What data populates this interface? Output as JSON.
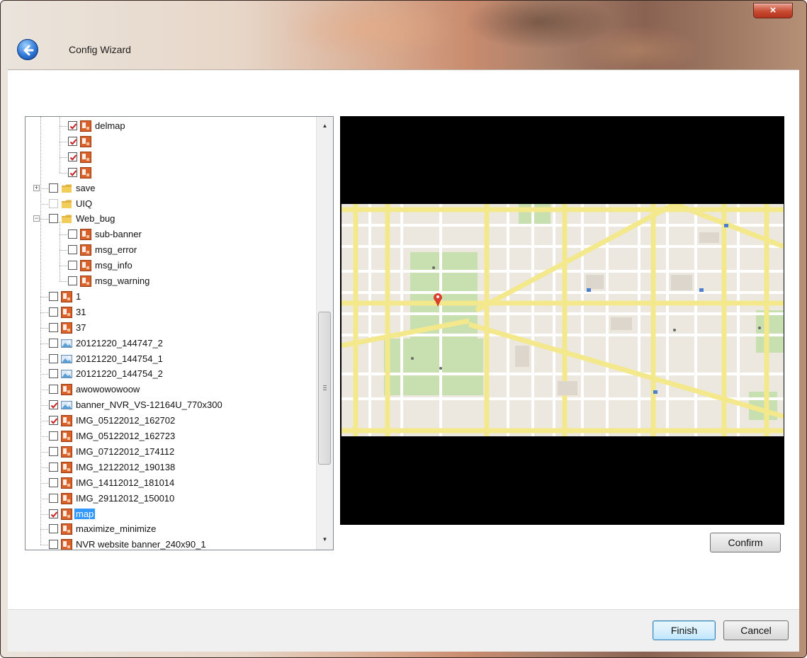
{
  "window": {
    "title": "Config Wizard",
    "close_glyph": "×",
    "back_icon": "back-arrow-icon",
    "close_icon": "close-icon"
  },
  "tree": {
    "items": [
      {
        "label": "delmap",
        "checked": true,
        "icon": "image-file-icon"
      },
      {
        "label": "",
        "checked": true,
        "icon": "image-file-icon"
      },
      {
        "label": "",
        "checked": true,
        "icon": "image-file-icon"
      },
      {
        "label": "",
        "checked": true,
        "icon": "image-file-icon"
      },
      {
        "label": "save",
        "checked": false,
        "icon": "folder-icon",
        "expander": "+"
      },
      {
        "label": "UIQ",
        "checked": false,
        "icon": "folder-icon"
      },
      {
        "label": "Web_bug",
        "checked": false,
        "icon": "folder-icon",
        "expander": "−"
      },
      {
        "label": "sub-banner",
        "checked": false,
        "icon": "image-file-icon"
      },
      {
        "label": "msg_error",
        "checked": false,
        "icon": "image-file-icon"
      },
      {
        "label": "msg_info",
        "checked": false,
        "icon": "image-file-icon"
      },
      {
        "label": "msg_warning",
        "checked": false,
        "icon": "image-file-icon"
      },
      {
        "label": "1",
        "checked": false,
        "icon": "image-file-icon"
      },
      {
        "label": "31",
        "checked": false,
        "icon": "image-file-icon"
      },
      {
        "label": "37",
        "checked": false,
        "icon": "image-file-icon"
      },
      {
        "label": "20121220_144747_2",
        "checked": false,
        "icon": "picture-icon"
      },
      {
        "label": "20121220_144754_1",
        "checked": false,
        "icon": "picture-icon"
      },
      {
        "label": "20121220_144754_2",
        "checked": false,
        "icon": "picture-icon"
      },
      {
        "label": "awowowowoow",
        "checked": false,
        "icon": "image-file-icon"
      },
      {
        "label": "banner_NVR_VS-12164U_770x300",
        "checked": true,
        "icon": "picture-icon"
      },
      {
        "label": "IMG_05122012_162702",
        "checked": true,
        "icon": "image-file-icon"
      },
      {
        "label": "IMG_05122012_162723",
        "checked": false,
        "icon": "image-file-icon"
      },
      {
        "label": "IMG_07122012_174112",
        "checked": false,
        "icon": "image-file-icon"
      },
      {
        "label": "IMG_12122012_190138",
        "checked": false,
        "icon": "image-file-icon"
      },
      {
        "label": "IMG_14112012_181014",
        "checked": false,
        "icon": "image-file-icon"
      },
      {
        "label": "IMG_29112012_150010",
        "checked": false,
        "icon": "image-file-icon"
      },
      {
        "label": "map",
        "checked": true,
        "icon": "image-file-icon",
        "selected": true
      },
      {
        "label": "maximize_minimize",
        "checked": false,
        "icon": "image-file-icon"
      },
      {
        "label": "NVR website banner_240x90_1",
        "checked": false,
        "icon": "image-file-icon"
      }
    ]
  },
  "scrollbar": {
    "up_glyph": "▲",
    "down_glyph": "▼"
  },
  "preview": {
    "image": "street-map-image"
  },
  "buttons": {
    "confirm": "Confirm",
    "finish": "Finish",
    "cancel": "Cancel"
  },
  "colors": {
    "selection": "#3399ff",
    "check": "#cc1f1f",
    "map_park": "#c8dfb0",
    "map_road": "#f4e88c"
  }
}
